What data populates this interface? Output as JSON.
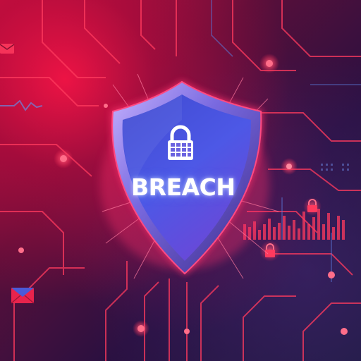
{
  "shield": {
    "label": "BREACH"
  },
  "colors": {
    "accent_red": "#ff2d55",
    "shield_blue": "#4a57e0",
    "shield_rim": "#8a7be8",
    "glow_pink": "#ff3c78"
  },
  "icons": {
    "center": "padlock-icon",
    "envelopes": "envelope-icon",
    "locks": "padlock-icon"
  }
}
